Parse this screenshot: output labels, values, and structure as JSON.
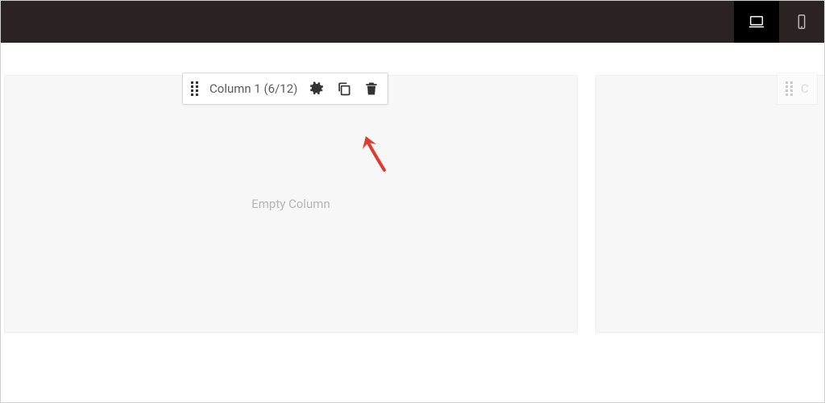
{
  "topbar": {
    "desktop_active": true
  },
  "column_toolbar": {
    "label": "Column 1 (6/12)"
  },
  "main_column": {
    "placeholder": "Empty Column"
  },
  "side_column": {
    "label_fragment": "C"
  },
  "annotation": {
    "arrow_target": "copy-button"
  }
}
